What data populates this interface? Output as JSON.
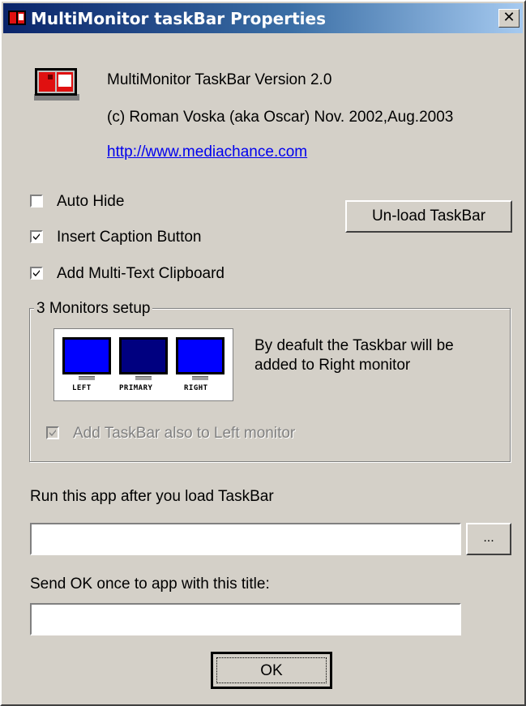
{
  "window": {
    "title": "MultiMonitor taskBar Properties",
    "close_glyph": "✕"
  },
  "about": {
    "version": "MultiMonitor TaskBar Version 2.0",
    "copyright": "(c) Roman Voska (aka Oscar) Nov. 2002,Aug.2003",
    "url": "http://www.mediachance.com"
  },
  "options": {
    "auto_hide": {
      "label": "Auto Hide",
      "checked": false
    },
    "insert_caption": {
      "label": "Insert Caption Button",
      "checked": true
    },
    "multi_clipboard": {
      "label": "Add Multi-Text Clipboard",
      "checked": true
    }
  },
  "unload_button": "Un-load TaskBar",
  "monitors": {
    "legend": "3 Monitors setup",
    "labels": [
      "LEFT",
      "PRIMARY",
      "RIGHT"
    ],
    "colors": [
      "#0000ff",
      "#000080",
      "#0000ff"
    ],
    "description": "By deafult the Taskbar will be added to Right monitor",
    "also_left": {
      "label": "Add TaskBar also to Left monitor",
      "checked": true,
      "disabled": true
    }
  },
  "run_app": {
    "label": "Run this app after you load TaskBar",
    "value": "",
    "browse_label": "..."
  },
  "send_ok": {
    "label": "Send OK once to app with this title:",
    "value": ""
  },
  "ok_button": "OK"
}
